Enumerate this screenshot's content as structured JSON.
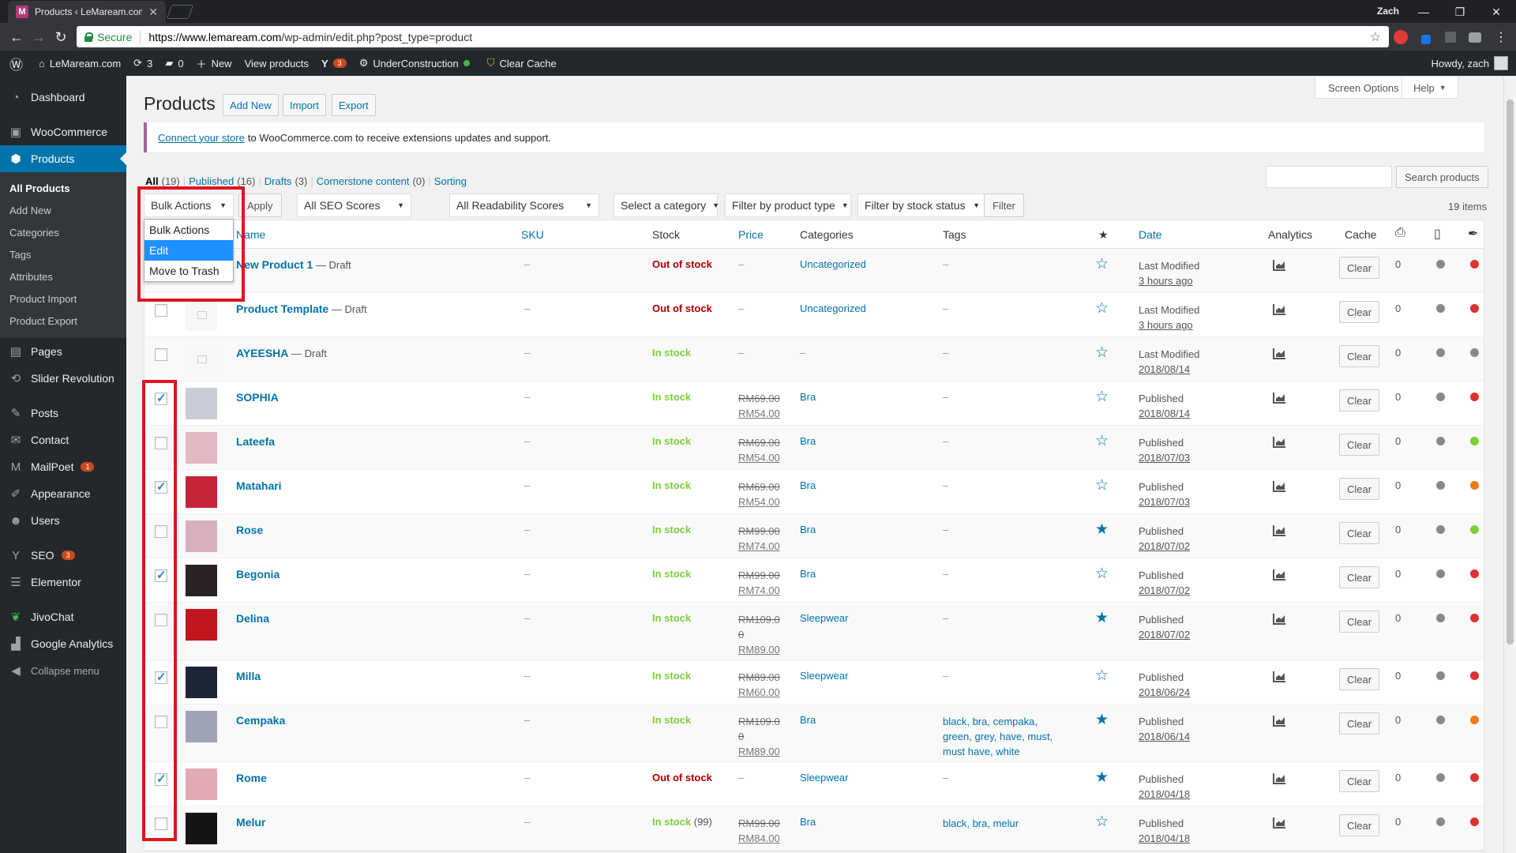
{
  "browser": {
    "tab_title": "Products ‹ LeMaream.com",
    "profile": "Zach",
    "secure_label": "Secure",
    "url_host": "https://www.lemaream.com",
    "url_path": "/wp-admin/edit.php?post_type=product"
  },
  "adminbar": {
    "site": "LeMaream.com",
    "updates": "3",
    "comments": "0",
    "new_label": "New",
    "view_products": "View products",
    "yoast_badge": "3",
    "under_construction": "UnderConstruction",
    "clear_cache": "Clear Cache",
    "howdy": "Howdy, zach"
  },
  "sidebar": {
    "dashboard": "Dashboard",
    "woocommerce": "WooCommerce",
    "products": "Products",
    "sub": [
      "All Products",
      "Add New",
      "Categories",
      "Tags",
      "Attributes",
      "Product Import",
      "Product Export"
    ],
    "pages": "Pages",
    "slider": "Slider Revolution",
    "posts": "Posts",
    "contact": "Contact",
    "mailpoet": "MailPoet",
    "mailpoet_badge": "1",
    "appearance": "Appearance",
    "users": "Users",
    "seo": "SEO",
    "seo_badge": "3",
    "elementor": "Elementor",
    "jivochat": "JivoChat",
    "google_analytics": "Google Analytics",
    "collapse": "Collapse menu"
  },
  "page": {
    "title": "Products",
    "add_new": "Add New",
    "import": "Import",
    "export": "Export",
    "screen_options": "Screen Options",
    "help": "Help",
    "notice_link": "Connect your store",
    "notice_text": "to WooCommerce.com to receive extensions updates and support."
  },
  "views": {
    "all": "All",
    "all_count": "(19)",
    "published": "Published",
    "published_count": "(16)",
    "drafts": "Drafts",
    "drafts_count": "(3)",
    "cornerstone": "Cornerstone content",
    "cornerstone_count": "(0)",
    "sorting": "Sorting"
  },
  "search": {
    "button": "Search products"
  },
  "filters": {
    "bulk_actions": "Bulk Actions",
    "apply": "Apply",
    "seo_scores": "All SEO Scores",
    "readability": "All Readability Scores",
    "category": "Select a category",
    "product_type": "Filter by product type",
    "stock_status": "Filter by stock status",
    "filter": "Filter",
    "items_count": "19 items"
  },
  "bulk_menu": [
    "Bulk Actions",
    "Edit",
    "Move to Trash"
  ],
  "columns": {
    "name": "Name",
    "sku": "SKU",
    "stock": "Stock",
    "price": "Price",
    "categories": "Categories",
    "tags": "Tags",
    "featured": "★",
    "date": "Date",
    "analytics": "Analytics",
    "cache": "Cache"
  },
  "clear_label": "Clear",
  "products": [
    {
      "name": "New Product 1",
      "status": "— Draft",
      "sku": "–",
      "stock": "Out of stock",
      "in_stock": false,
      "qty": "",
      "price_old": "",
      "price_new": "",
      "price_dash": "–",
      "category": "Uncategorized",
      "tags": "–",
      "featured": false,
      "date_status": "Last Modified",
      "date": "3 hours ago",
      "count": "0",
      "seo": "gray",
      "read": "red",
      "checked": false,
      "thumb": "none"
    },
    {
      "name": "Product Template",
      "status": "— Draft",
      "sku": "–",
      "stock": "Out of stock",
      "in_stock": false,
      "qty": "",
      "price_old": "",
      "price_new": "",
      "price_dash": "–",
      "category": "Uncategorized",
      "tags": "–",
      "featured": false,
      "date_status": "Last Modified",
      "date": "3 hours ago",
      "count": "0",
      "seo": "gray",
      "read": "red",
      "checked": false,
      "thumb": "placeholder"
    },
    {
      "name": "AYEESHA",
      "status": "— Draft",
      "sku": "–",
      "stock": "In stock",
      "in_stock": true,
      "qty": "",
      "price_old": "",
      "price_new": "",
      "price_dash": "–",
      "category": "–",
      "tags": "–",
      "featured": false,
      "date_status": "Last Modified",
      "date": "2018/08/14",
      "count": "0",
      "seo": "gray",
      "read": "gray",
      "checked": false,
      "thumb": "placeholder"
    },
    {
      "name": "SOPHIA",
      "status": "",
      "sku": "–",
      "stock": "In stock",
      "in_stock": true,
      "qty": "",
      "price_old": "RM69.00",
      "price_new": "RM54.00",
      "price_dash": "",
      "category": "Bra",
      "tags": "–",
      "featured": false,
      "date_status": "Published",
      "date": "2018/08/14",
      "count": "0",
      "seo": "gray",
      "read": "red",
      "checked": true,
      "thumb": "#c9ccd6"
    },
    {
      "name": "Lateefa",
      "status": "",
      "sku": "–",
      "stock": "In stock",
      "in_stock": true,
      "qty": "",
      "price_old": "RM69.00",
      "price_new": "RM54.00",
      "price_dash": "",
      "category": "Bra",
      "tags": "–",
      "featured": false,
      "date_status": "Published",
      "date": "2018/07/03",
      "count": "0",
      "seo": "gray",
      "read": "green",
      "checked": false,
      "thumb": "#e3b9c4"
    },
    {
      "name": "Matahari",
      "status": "",
      "sku": "–",
      "stock": "In stock",
      "in_stock": true,
      "qty": "",
      "price_old": "RM69.00",
      "price_new": "RM54.00",
      "price_dash": "",
      "category": "Bra",
      "tags": "–",
      "featured": false,
      "date_status": "Published",
      "date": "2018/07/03",
      "count": "0",
      "seo": "gray",
      "read": "orange",
      "checked": true,
      "thumb": "#c4233a"
    },
    {
      "name": "Rose",
      "status": "",
      "sku": "–",
      "stock": "In stock",
      "in_stock": true,
      "qty": "",
      "price_old": "RM99.00",
      "price_new": "RM74.00",
      "price_dash": "",
      "category": "Bra",
      "tags": "–",
      "featured": true,
      "date_status": "Published",
      "date": "2018/07/02",
      "count": "0",
      "seo": "gray",
      "read": "green",
      "checked": false,
      "thumb": "#d8b0bc"
    },
    {
      "name": "Begonia",
      "status": "",
      "sku": "–",
      "stock": "In stock",
      "in_stock": true,
      "qty": "",
      "price_old": "RM99.00",
      "price_new": "RM74.00",
      "price_dash": "",
      "category": "Bra",
      "tags": "–",
      "featured": false,
      "date_status": "Published",
      "date": "2018/07/02",
      "count": "0",
      "seo": "gray",
      "read": "red",
      "checked": true,
      "thumb": "#2a2226"
    },
    {
      "name": "Delina",
      "status": "",
      "sku": "–",
      "stock": "In stock",
      "in_stock": true,
      "qty": "",
      "price_old": "RM109.0 0",
      "price_new": "RM89.00",
      "price_dash": "",
      "category": "Sleepwear",
      "tags": "–",
      "featured": true,
      "date_status": "Published",
      "date": "2018/07/02",
      "count": "0",
      "seo": "gray",
      "read": "red",
      "checked": false,
      "thumb": "#c0161e"
    },
    {
      "name": "Milla",
      "status": "",
      "sku": "–",
      "stock": "In stock",
      "in_stock": true,
      "qty": "",
      "price_old": "RM89.00",
      "price_new": "RM60.00",
      "price_dash": "",
      "category": "Sleepwear",
      "tags": "–",
      "featured": false,
      "date_status": "Published",
      "date": "2018/06/24",
      "count": "0",
      "seo": "gray",
      "read": "red",
      "checked": true,
      "thumb": "#1d2538"
    },
    {
      "name": "Cempaka",
      "status": "",
      "sku": "–",
      "stock": "In stock",
      "in_stock": true,
      "qty": "",
      "price_old": "RM109.0 0",
      "price_new": "RM89.00",
      "price_dash": "",
      "category": "Bra",
      "tags": "black, bra, cempaka, green, grey, have, must, must have, white",
      "featured": true,
      "date_status": "Published",
      "date": "2018/06/14",
      "count": "0",
      "seo": "gray",
      "read": "orange",
      "checked": false,
      "thumb": "#9ea4b5"
    },
    {
      "name": "Rome",
      "status": "",
      "sku": "–",
      "stock": "Out of stock",
      "in_stock": false,
      "qty": "",
      "price_old": "",
      "price_new": "",
      "price_dash": "–",
      "category": "Sleepwear",
      "tags": "–",
      "featured": true,
      "date_status": "Published",
      "date": "2018/04/18",
      "count": "0",
      "seo": "gray",
      "read": "red",
      "checked": true,
      "thumb": "#e2aab4"
    },
    {
      "name": "Melur",
      "status": "",
      "sku": "–",
      "stock": "In stock",
      "in_stock": true,
      "qty": "(99)",
      "price_old": "RM99.00",
      "price_new": "RM84.00",
      "price_dash": "",
      "category": "Bra",
      "tags": "black, bra, melur",
      "featured": false,
      "date_status": "Published",
      "date": "2018/04/18",
      "count": "0",
      "seo": "gray",
      "read": "red",
      "checked": false,
      "thumb": "#141414"
    }
  ]
}
